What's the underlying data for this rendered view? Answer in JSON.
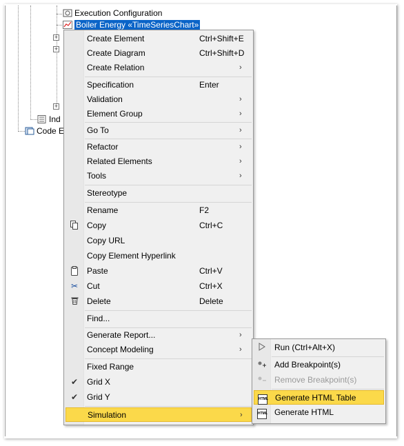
{
  "tree": {
    "node_execution": "Execution Configuration",
    "node_selected": "Boiler Energy «TimeSeriesChart»",
    "node_ind": "Ind",
    "node_code": "Code E"
  },
  "menu": {
    "items": [
      {
        "label": "Create Element",
        "shortcut": "Ctrl+Shift+E",
        "submenu": false
      },
      {
        "label": "Create Diagram",
        "shortcut": "Ctrl+Shift+D",
        "submenu": false
      },
      {
        "label": "Create Relation",
        "shortcut": "",
        "submenu": true
      },
      {
        "label": "Specification",
        "shortcut": "Enter",
        "submenu": false
      },
      {
        "label": "Validation",
        "shortcut": "",
        "submenu": true
      },
      {
        "label": "Element Group",
        "shortcut": "",
        "submenu": true
      },
      {
        "label": "Go To",
        "shortcut": "",
        "submenu": true
      },
      {
        "label": "Refactor",
        "shortcut": "",
        "submenu": true
      },
      {
        "label": "Related Elements",
        "shortcut": "",
        "submenu": true
      },
      {
        "label": "Tools",
        "shortcut": "",
        "submenu": true
      },
      {
        "label": "Stereotype",
        "shortcut": "",
        "submenu": false
      },
      {
        "label": "Rename",
        "shortcut": "F2",
        "submenu": false
      },
      {
        "label": "Copy",
        "shortcut": "Ctrl+C",
        "submenu": false,
        "icon": "copy-icon"
      },
      {
        "label": "Copy URL",
        "shortcut": "",
        "submenu": false
      },
      {
        "label": "Copy Element Hyperlink",
        "shortcut": "",
        "submenu": false
      },
      {
        "label": "Paste",
        "shortcut": "Ctrl+V",
        "submenu": false,
        "icon": "paste-icon"
      },
      {
        "label": "Cut",
        "shortcut": "Ctrl+X",
        "submenu": false,
        "icon": "scissors-icon"
      },
      {
        "label": "Delete",
        "shortcut": "Delete",
        "submenu": false,
        "icon": "trash-icon"
      },
      {
        "label": "Find...",
        "shortcut": "",
        "submenu": false
      },
      {
        "label": "Generate Report...",
        "shortcut": "",
        "submenu": true
      },
      {
        "label": "Concept Modeling",
        "shortcut": "",
        "submenu": true
      },
      {
        "label": "Fixed Range",
        "shortcut": "",
        "submenu": false
      },
      {
        "label": "Grid X",
        "shortcut": "",
        "submenu": false,
        "checked": true
      },
      {
        "label": "Grid Y",
        "shortcut": "",
        "submenu": false,
        "checked": true
      },
      {
        "label": "Simulation",
        "shortcut": "",
        "submenu": true,
        "highlighted": true
      }
    ],
    "arrow_glyph": "›",
    "check_glyph": "✔"
  },
  "submenu": {
    "items": [
      {
        "label": "Run (Ctrl+Alt+X)",
        "icon": "play-icon",
        "enabled": true
      },
      {
        "label": "Add Breakpoint(s)",
        "icon": "add-breakpoint-icon",
        "enabled": true
      },
      {
        "label": "Remove Breakpoint(s)",
        "icon": "remove-breakpoint-icon",
        "enabled": false
      },
      {
        "label": "Generate HTML Table",
        "icon": "html-table-icon",
        "enabled": true,
        "highlighted": true
      },
      {
        "label": "Generate HTML",
        "icon": "html-icon",
        "enabled": true
      }
    ],
    "html_icon_text": "HTML"
  },
  "colors": {
    "highlight": "#fbd94a",
    "selection": "#0a64c8",
    "menu_bg": "#f0f0f0"
  }
}
